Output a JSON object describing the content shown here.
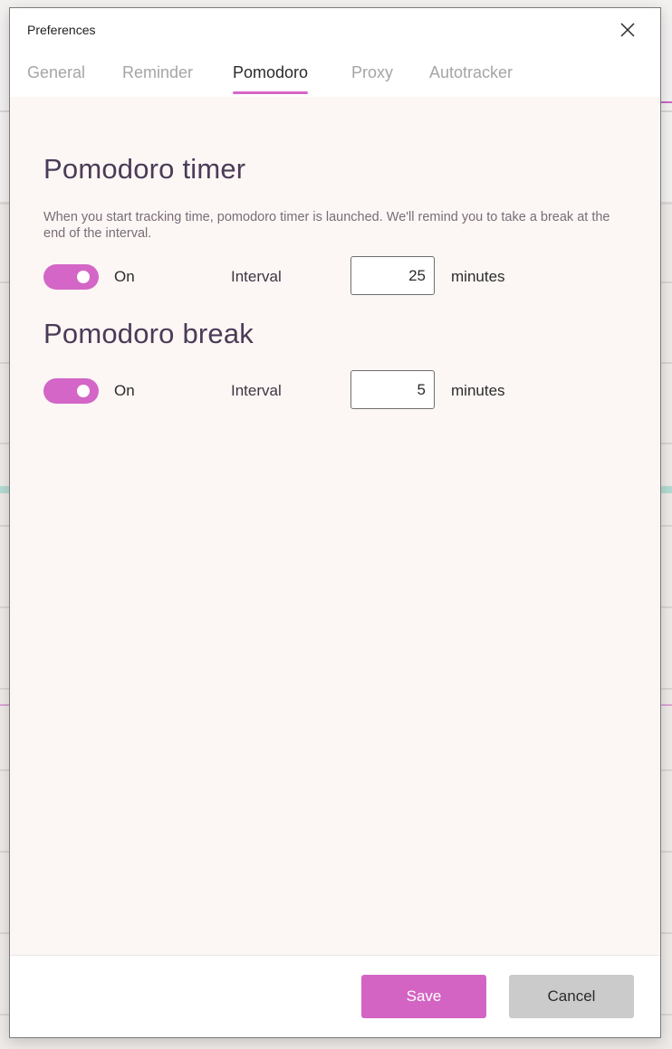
{
  "dialog": {
    "title": "Preferences",
    "close_icon": "close-icon"
  },
  "tabs": [
    {
      "label": "General",
      "active": false
    },
    {
      "label": "Reminder",
      "active": false
    },
    {
      "label": "Pomodoro",
      "active": true
    },
    {
      "label": "Proxy",
      "active": false
    },
    {
      "label": "Autotracker",
      "active": false
    }
  ],
  "pomodoro_timer": {
    "title": "Pomodoro timer",
    "description": "When you start tracking time, pomodoro timer is launched. We'll remind you to take a break at the end of the interval.",
    "toggle_state": "on",
    "toggle_label": "On",
    "interval_label": "Interval",
    "interval_value": "25",
    "unit_label": "minutes"
  },
  "pomodoro_break": {
    "title": "Pomodoro break",
    "toggle_state": "on",
    "toggle_label": "On",
    "interval_label": "Interval",
    "interval_value": "5",
    "unit_label": "minutes"
  },
  "footer": {
    "save_label": "Save",
    "cancel_label": "Cancel"
  },
  "colors": {
    "accent": "#d366c6",
    "content_background": "#fcf7f5",
    "heading": "#4b3b57",
    "cancel_button": "#cbcbcb"
  }
}
